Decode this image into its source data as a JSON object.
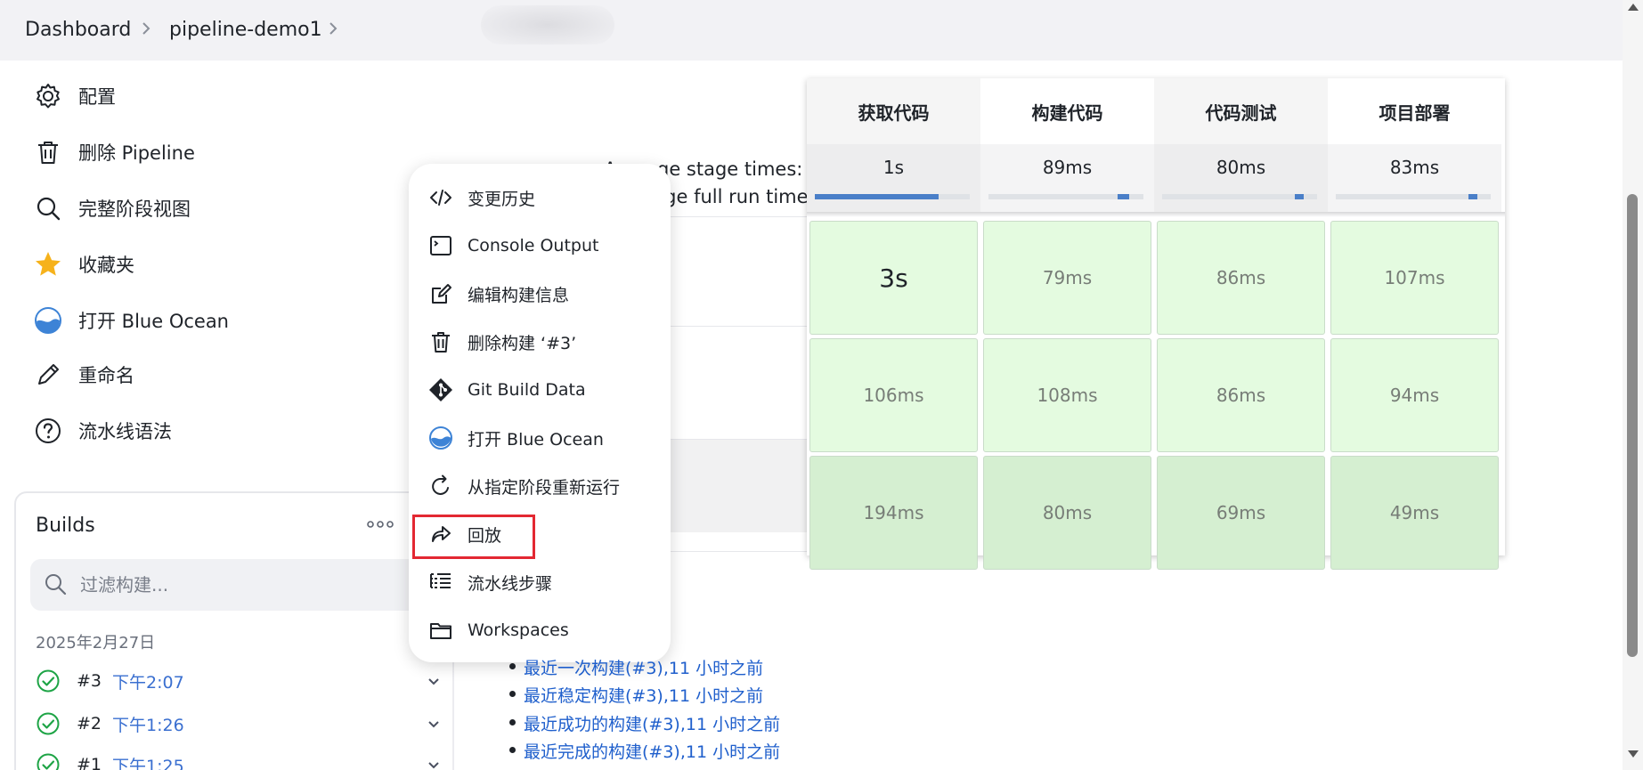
{
  "breadcrumb": {
    "items": [
      "Dashboard",
      "pipeline-demo1"
    ]
  },
  "sidebar": {
    "items": [
      {
        "label": "配置",
        "icon": "gear-icon"
      },
      {
        "label": "删除 Pipeline",
        "icon": "trash-icon"
      },
      {
        "label": "完整阶段视图",
        "icon": "search-icon"
      },
      {
        "label": "收藏夹",
        "icon": "star-icon"
      },
      {
        "label": "打开 Blue Ocean",
        "icon": "blue-ocean-icon"
      },
      {
        "label": "重命名",
        "icon": "pencil-icon"
      },
      {
        "label": "流水线语法",
        "icon": "help-circle-icon"
      }
    ]
  },
  "builds": {
    "title": "Builds",
    "filter_placeholder": "过滤构建...",
    "date": "2025年2月27日",
    "rows": [
      {
        "number": "#3",
        "time": "下午2:07",
        "status": "success"
      },
      {
        "number": "#2",
        "time": "下午1:26",
        "status": "success"
      },
      {
        "number": "#1",
        "time": "下午1:25",
        "status": "success"
      }
    ]
  },
  "stage_view": {
    "avg_stage_label": "Average stage times:",
    "avg_run_label": "(Average full run time: ~4s)",
    "columns": [
      "获取代码",
      "构建代码",
      "代码测试",
      "项目部署"
    ],
    "avg_times": [
      "1s",
      "89ms",
      "80ms",
      "83ms"
    ],
    "avg_fill": [
      0.8,
      0.12,
      0.1,
      0.1
    ],
    "rows": [
      [
        "3s",
        "79ms",
        "86ms",
        "107ms"
      ],
      [
        "106ms",
        "108ms",
        "86ms",
        "94ms"
      ],
      [
        "194ms",
        "80ms",
        "69ms",
        "49ms"
      ]
    ],
    "colors": {
      "success_light": "#e4fbe0",
      "success_dark": "#d5efd1"
    }
  },
  "context_menu": {
    "items": [
      {
        "label": "变更历史",
        "icon": "code-icon"
      },
      {
        "label": "Console Output",
        "icon": "terminal-icon"
      },
      {
        "label": "编辑构建信息",
        "icon": "edit-icon"
      },
      {
        "label": "删除构建 ‘#3’",
        "icon": "trash-icon"
      },
      {
        "label": "Git Build Data",
        "icon": "git-icon"
      },
      {
        "label": "打开 Blue Ocean",
        "icon": "blue-ocean-icon"
      },
      {
        "label": "从指定阶段重新运行",
        "icon": "refresh-icon"
      },
      {
        "label": "回放",
        "icon": "replay-icon"
      },
      {
        "label": "流水线步骤",
        "icon": "list-icon"
      },
      {
        "label": "Workspaces",
        "icon": "folder-icon"
      }
    ],
    "highlighted": "回放",
    "highlight_color": "#e32832"
  },
  "permalinks": [
    "最近一次构建(#3),11 小时之前",
    "最近稳定构建(#3),11 小时之前",
    "最近成功的构建(#3),11 小时之前",
    "最近完成的构建(#3),11 小时之前"
  ]
}
